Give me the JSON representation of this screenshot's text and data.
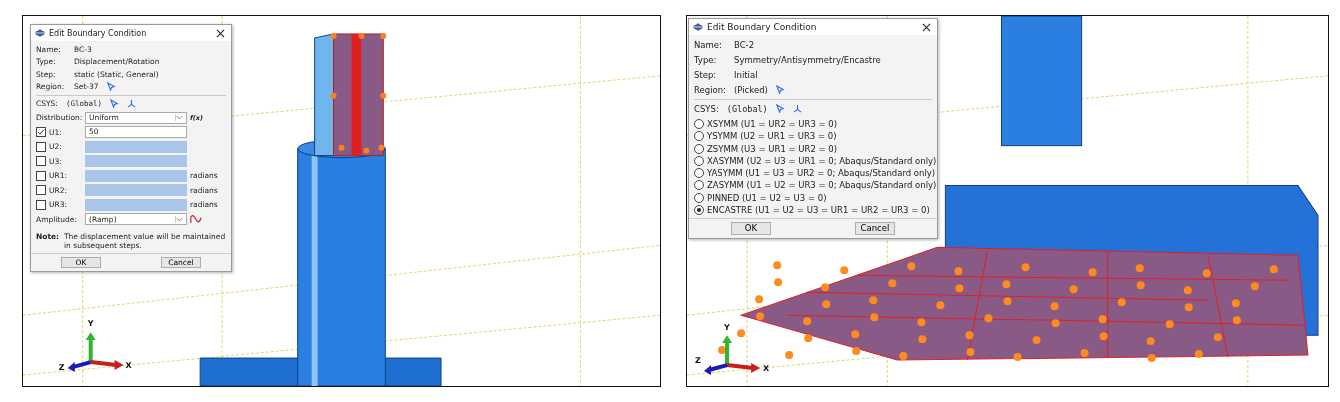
{
  "panels": [
    {
      "kind": "displacement",
      "dialog": {
        "title": "Edit Boundary Condition",
        "info": [
          {
            "label": "Name:",
            "value": "BC-3"
          },
          {
            "label": "Type:",
            "value": "Displacement/Rotation"
          },
          {
            "label": "Step:",
            "value": "static (Static, General)"
          },
          {
            "label": "Region:",
            "value": "Set-37"
          }
        ],
        "csys": {
          "label": "CSYS:",
          "value": "(Global)"
        },
        "distribution": {
          "label": "Distribution:",
          "value": "Uniform",
          "fx": "f(x)"
        },
        "dofs": [
          {
            "label": "U1:",
            "checked": true,
            "value": "50"
          },
          {
            "label": "U2:",
            "checked": false
          },
          {
            "label": "U3:",
            "checked": false
          },
          {
            "label": "UR1:",
            "checked": false,
            "unit": "radians"
          },
          {
            "label": "UR2:",
            "checked": false,
            "unit": "radians"
          },
          {
            "label": "UR3:",
            "checked": false,
            "unit": "radians"
          }
        ],
        "amplitude": {
          "label": "Amplitude:",
          "value": "(Ramp)"
        },
        "note": {
          "label": "Note:",
          "text": "The displacement value will be maintained in subsequent steps."
        },
        "buttons": [
          "OK",
          "Cancel"
        ]
      },
      "triad": {
        "x": "X",
        "y": "Y",
        "z": "Z"
      }
    },
    {
      "kind": "symmetry",
      "dialog": {
        "title": "Edit Boundary Condition",
        "info": [
          {
            "label": "Name:",
            "value": "BC-2"
          },
          {
            "label": "Type:",
            "value": "Symmetry/Antisymmetry/Encastre"
          },
          {
            "label": "Step:",
            "value": "Initial"
          },
          {
            "label": "Region:",
            "value": "(Picked)"
          }
        ],
        "csys": {
          "label": "CSYS:",
          "value": "(Global)"
        },
        "options": [
          {
            "label": "XSYMM (U1 = UR2 = UR3 = 0)",
            "selected": false
          },
          {
            "label": "YSYMM (U2 = UR1 = UR3 = 0)",
            "selected": false
          },
          {
            "label": "ZSYMM (U3 = UR1 = UR2 = 0)",
            "selected": false
          },
          {
            "label": "XASYMM (U2 = U3 = UR1 = 0; Abaqus/Standard only)",
            "selected": false
          },
          {
            "label": "YASYMM (U1 = U3 = UR2 = 0; Abaqus/Standard only)",
            "selected": false
          },
          {
            "label": "ZASYMM (U1 = U2 = UR3 = 0; Abaqus/Standard only)",
            "selected": false
          },
          {
            "label": "PINNED (U1 = U2 = U3 = 0)",
            "selected": false
          },
          {
            "label": "ENCASTRE (U1 = U2 = U3 = UR1 = UR2 = UR3 = 0)",
            "selected": true
          }
        ],
        "buttons": [
          "OK",
          "Cancel"
        ]
      },
      "triad": {
        "x": "X",
        "y": "Y",
        "z": "Z"
      }
    }
  ]
}
